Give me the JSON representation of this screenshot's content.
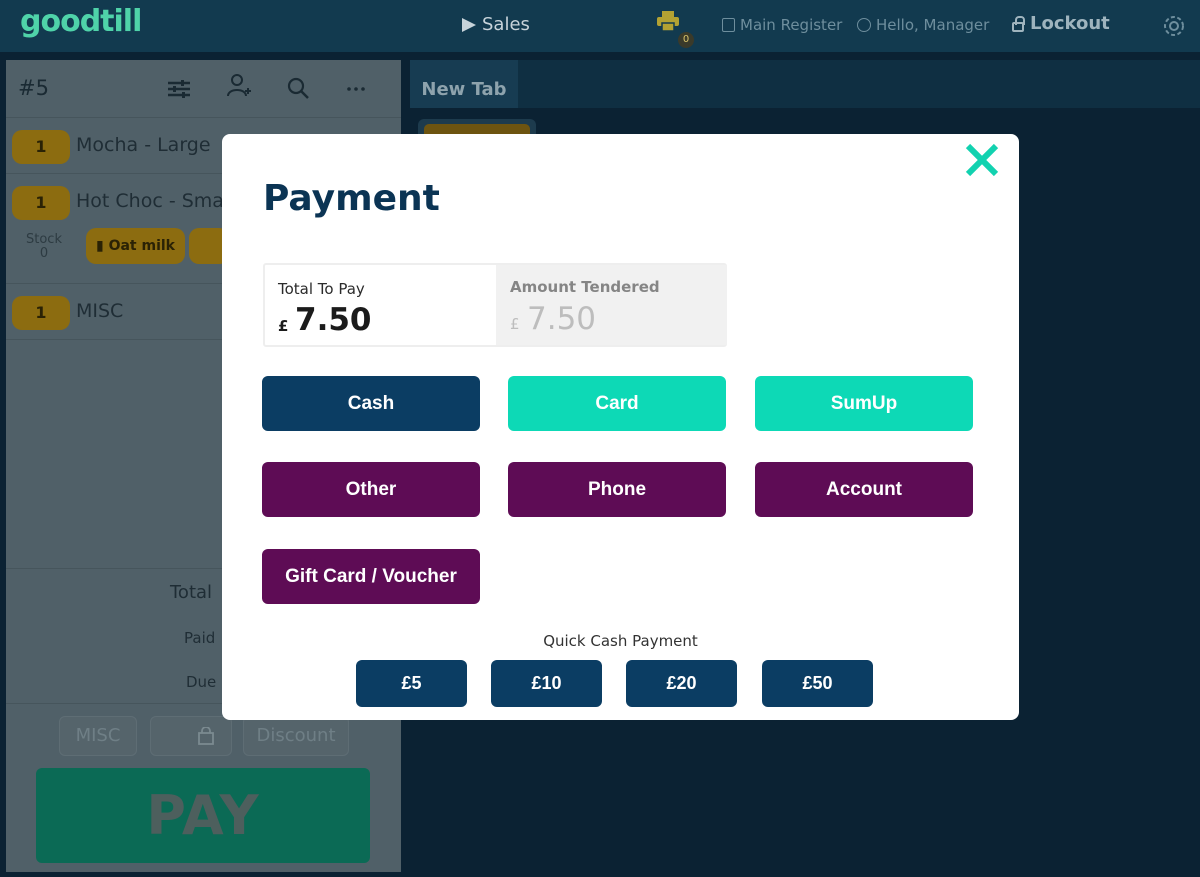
{
  "app": {
    "logo": "goodtill"
  },
  "topbar": {
    "sales_label": "Sales",
    "printer_count": "0",
    "register_label": "Main Register",
    "greeting": "Hello, Manager",
    "lockout_label": "Lockout"
  },
  "order": {
    "number": "#5",
    "items": [
      {
        "qty": "1",
        "name": "Mocha - Large"
      },
      {
        "qty": "1",
        "name": "Hot Choc - Sma"
      },
      {
        "qty": "1",
        "name": "MISC"
      }
    ],
    "stock_label": "Stock",
    "stock_value": "0",
    "modifier": "Oat milk",
    "total_label": "Total",
    "paid_label": "Paid",
    "due_label": "Due",
    "misc_button": "MISC",
    "discount_button": "Discount",
    "pay_button": "PAY"
  },
  "tabs": {
    "new_tab": "New Tab"
  },
  "payment": {
    "title": "Payment",
    "total_to_pay_label": "Total To Pay",
    "currency": "£",
    "total_to_pay": "7.50",
    "amount_tendered_label": "Amount Tendered",
    "amount_tendered": "7.50",
    "methods": [
      {
        "label": "Cash",
        "color": "#0b3d63"
      },
      {
        "label": "Card",
        "color": "#0dd9b6"
      },
      {
        "label": "SumUp",
        "color": "#0dd9b6"
      },
      {
        "label": "Other",
        "color": "#5e0c55"
      },
      {
        "label": "Phone",
        "color": "#5e0c55"
      },
      {
        "label": "Account",
        "color": "#5e0c55"
      },
      {
        "label": "Gift Card / Voucher",
        "color": "#5e0c55"
      }
    ],
    "quick_cash_label": "Quick Cash Payment",
    "quick_cash": [
      "£5",
      "£10",
      "£20",
      "£50"
    ]
  },
  "colors": {
    "accent_teal": "#0dd9b6",
    "navy": "#0b3d63",
    "purple": "#5e0c55",
    "logo_green": "#4fd3a9"
  }
}
